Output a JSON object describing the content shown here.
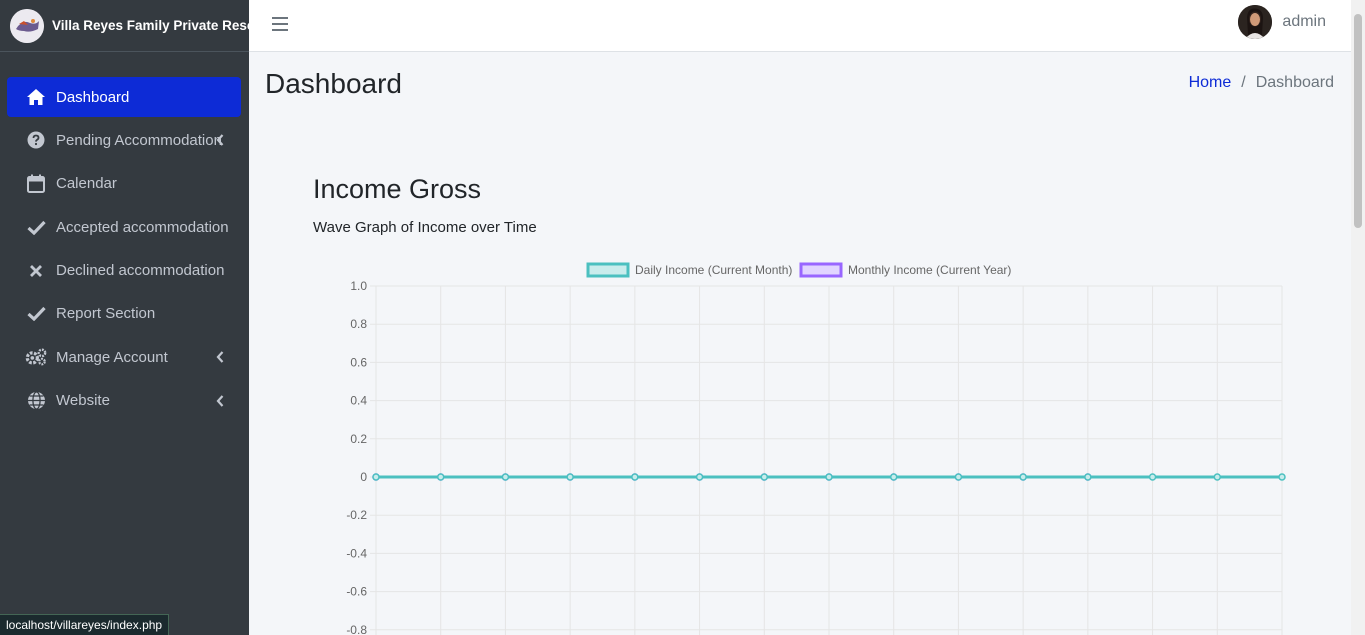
{
  "brand": {
    "name": "Villa Reyes Family Private Resort"
  },
  "sidebar": {
    "items": [
      {
        "label": "Dashboard",
        "icon": "home-icon",
        "active": true
      },
      {
        "label": "Pending Accommodation",
        "icon": "question-circle-icon",
        "caret": true
      },
      {
        "label": "Calendar",
        "icon": "calendar-icon"
      },
      {
        "label": "Accepted accommodation",
        "icon": "check-icon"
      },
      {
        "label": "Declined accommodation",
        "icon": "x-icon"
      },
      {
        "label": "Report Section",
        "icon": "check-icon"
      },
      {
        "label": "Manage Account",
        "icon": "gears-icon",
        "caret": true
      },
      {
        "label": "Website",
        "icon": "globe-icon",
        "caret": true
      }
    ]
  },
  "header": {
    "user_name": "admin"
  },
  "page": {
    "title": "Dashboard",
    "breadcrumb": [
      "Home",
      "Dashboard"
    ]
  },
  "section": {
    "title": "Income Gross",
    "subtitle": "Wave Graph of Income over Time"
  },
  "status_url": "localhost/villareyes/index.php",
  "colors": {
    "accent": "#0d2bd6",
    "sidebar_bg": "#343a40",
    "daily": "#4bc0c0",
    "monthly": "#9966ff"
  },
  "chart_data": {
    "type": "line",
    "title": "",
    "xlabel": "",
    "ylabel": "",
    "ylim": [
      -0.8,
      1.0
    ],
    "y_ticks": [
      "1.0",
      "0.8",
      "0.6",
      "0.4",
      "0.2",
      "0",
      "-0.2",
      "-0.4",
      "-0.6",
      "-0.8"
    ],
    "legend_position": "top",
    "grid": true,
    "series": [
      {
        "name": "Daily Income (Current Month)",
        "color": "#4bc0c0",
        "fill": "#c9ecec",
        "values": [
          0,
          0,
          0,
          0,
          0,
          0,
          0,
          0,
          0,
          0,
          0,
          0,
          0,
          0,
          0
        ]
      },
      {
        "name": "Monthly Income (Current Year)",
        "color": "#9966ff",
        "fill": "#e1d4ff",
        "values": [
          0,
          0,
          0,
          0,
          0,
          0,
          0,
          0,
          0,
          0,
          0,
          0
        ]
      }
    ]
  }
}
